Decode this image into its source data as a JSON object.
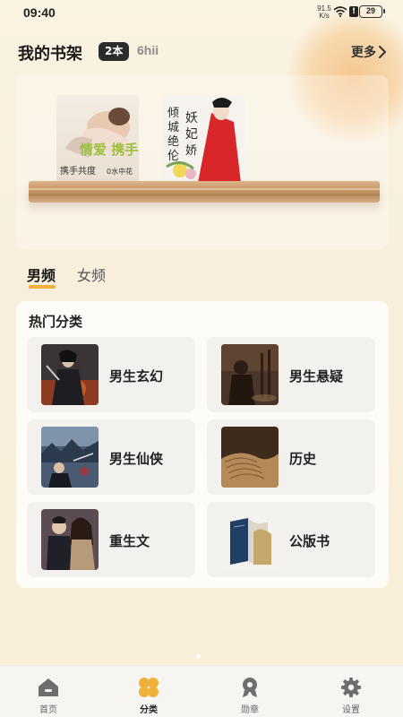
{
  "status_bar": {
    "time": "09:40",
    "net_speed": "91.5 K/s",
    "battery": "29"
  },
  "shelf": {
    "title": "我的书架",
    "count_badge": "2本",
    "extra_text": "6hii",
    "more_label": "更多",
    "books": [
      {
        "cover_text": "情爱 携手共度",
        "cover_sub": "0水中花"
      },
      {
        "cover_text": "倾城绝伦 妖妃娇宠颜",
        "cover_sub": ""
      }
    ]
  },
  "tabs": [
    {
      "label": "男频",
      "active": true
    },
    {
      "label": "女频",
      "active": false
    }
  ],
  "hot_categories": {
    "title": "热门分类",
    "items": [
      {
        "label": "男生玄幻",
        "icon": "fantasy-cover"
      },
      {
        "label": "男生悬疑",
        "icon": "mystery-cover"
      },
      {
        "label": "男生仙侠",
        "icon": "xianxia-cover"
      },
      {
        "label": "历史",
        "icon": "history-cover"
      },
      {
        "label": "重生文",
        "icon": "rebirth-cover"
      },
      {
        "label": "公版书",
        "icon": "public-domain-cover"
      }
    ]
  },
  "bottom_nav": [
    {
      "label": "首页",
      "icon": "home-icon",
      "active": false
    },
    {
      "label": "分类",
      "icon": "category-icon",
      "active": true
    },
    {
      "label": "勋章",
      "icon": "medal-icon",
      "active": false
    },
    {
      "label": "设置",
      "icon": "settings-icon",
      "active": false
    }
  ],
  "colors": {
    "accent": "#f0b13a",
    "background": "#f8efdc",
    "text_primary": "#222222"
  }
}
